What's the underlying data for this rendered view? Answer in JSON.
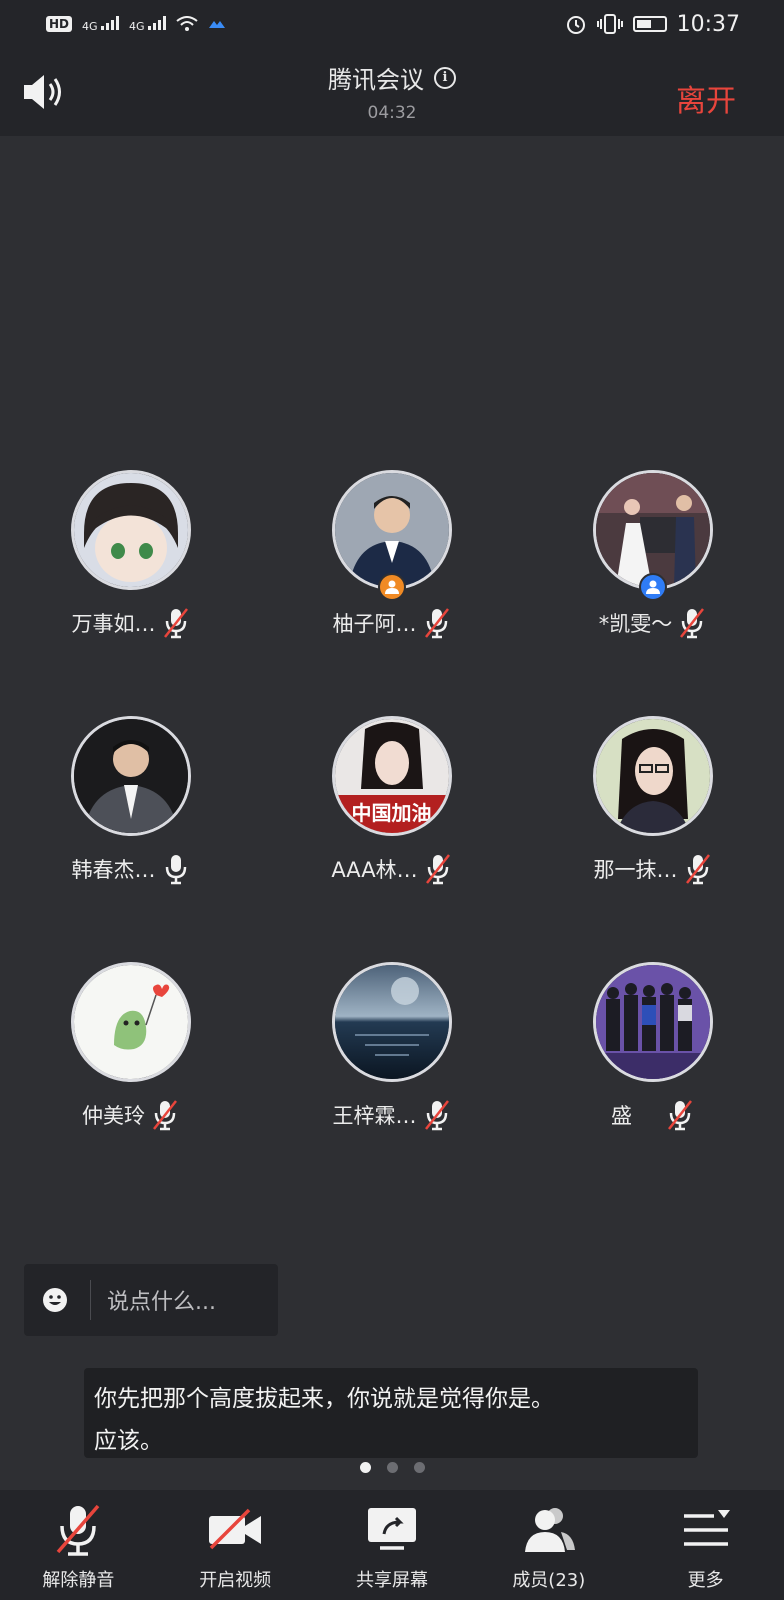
{
  "status_bar": {
    "hd": "HD",
    "sim1": "4G",
    "sim2": "4G",
    "time": "10:37"
  },
  "header": {
    "title": "腾讯会议",
    "timer": "04:32",
    "leave_label": "离开"
  },
  "participants": [
    {
      "name": "万事如…",
      "mic": "muted",
      "badge": null
    },
    {
      "name": "柚子阿…",
      "mic": "muted",
      "badge": "host"
    },
    {
      "name": "*凯雯～",
      "mic": "muted",
      "badge": "cohost"
    },
    {
      "name": "韩春杰…",
      "mic": "on",
      "badge": null
    },
    {
      "name": "AAA林…",
      "mic": "muted",
      "badge": null,
      "avatar_text": "中国加油"
    },
    {
      "name": "那一抹…",
      "mic": "muted",
      "badge": null
    },
    {
      "name": "仲美玲",
      "mic": "muted",
      "badge": null
    },
    {
      "name": "王梓霖…",
      "mic": "muted",
      "badge": null
    },
    {
      "name": "盛",
      "mic": "muted",
      "badge": null
    }
  ],
  "chat": {
    "placeholder": "说点什么..."
  },
  "caption": {
    "line1": "你先把那个高度拔起来，你说就是觉得你是。",
    "line2": "应该。"
  },
  "pager": {
    "total": 3,
    "active": 1
  },
  "toolbar": {
    "unmute_label": "解除静音",
    "video_label": "开启视频",
    "share_label": "共享屏幕",
    "members_label": "成员(23)",
    "more_label": "更多"
  },
  "colors": {
    "background": "#2e2f33",
    "bar": "#242529",
    "leave_red": "#e8453c",
    "mute_red": "#e8453c",
    "host_orange": "#f08a24",
    "cohost_blue": "#2f7cf6"
  }
}
